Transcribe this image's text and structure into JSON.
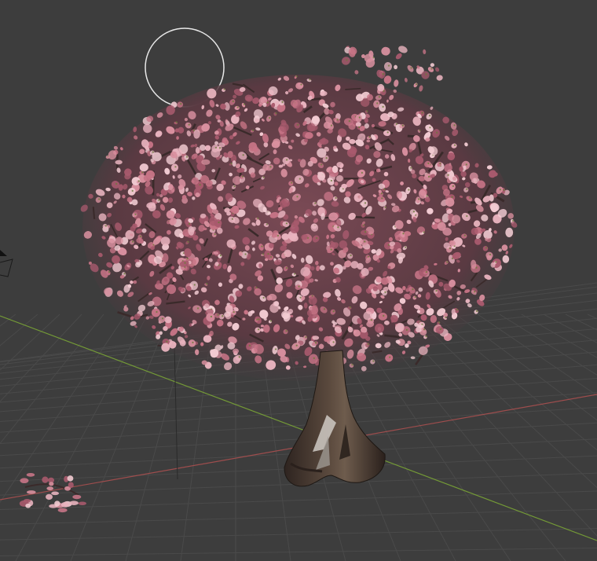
{
  "viewport": {
    "background": "#3d3d3d",
    "grid_color": "#4a4a4a",
    "axis_x_color": "#b05050",
    "axis_y_color": "#7aa536"
  },
  "objects": {
    "light_gizmo": {
      "icon": "light-circle-icon",
      "color": "#e8e8e8"
    },
    "camera_gizmo": {
      "icon": "camera-icon",
      "color": "#1a1a1a"
    },
    "tree": {
      "blossom_colors": [
        "#d9909f",
        "#c77486",
        "#e8b3be",
        "#a85a6d",
        "#f2cbd2"
      ],
      "branch_color": "#3a2a2a",
      "trunk_color": "#4a3a30"
    },
    "fallen_branch": {
      "blossom_color": "#d9909f"
    }
  }
}
